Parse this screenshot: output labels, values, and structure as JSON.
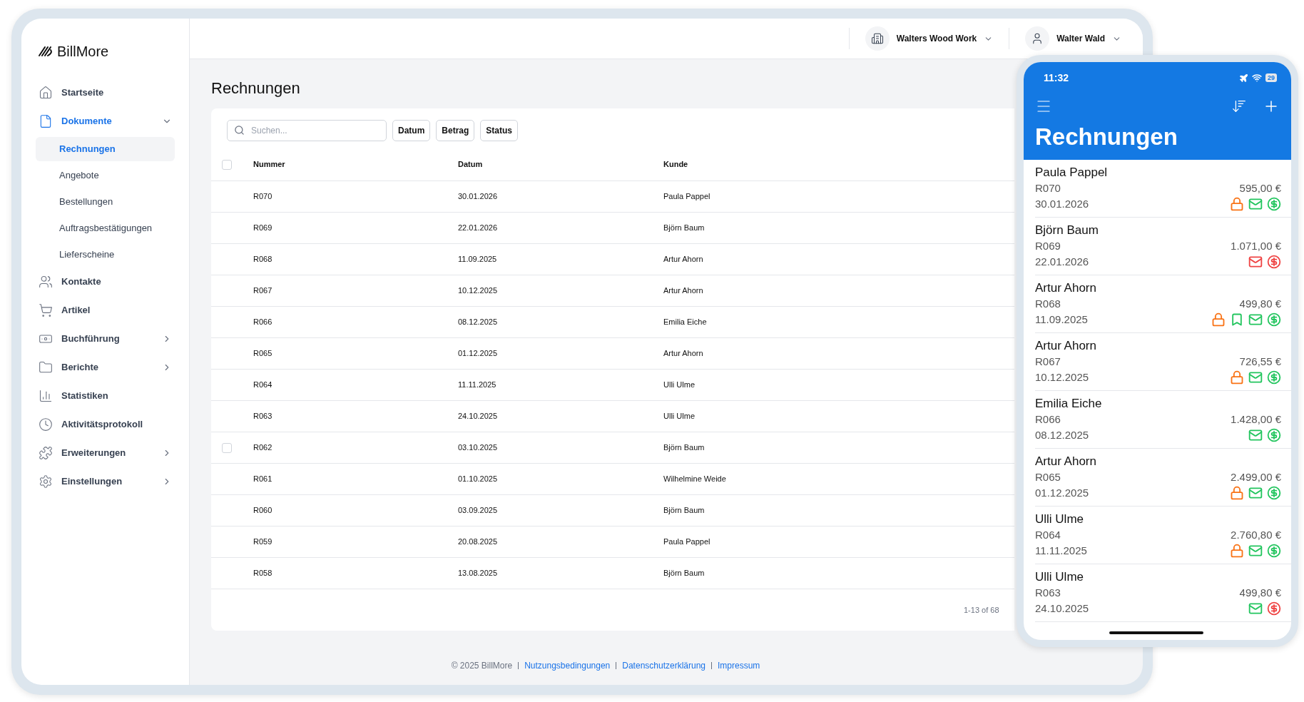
{
  "brand": "BillMore",
  "sidebar": {
    "items": [
      {
        "label": "Startseite",
        "selected": false
      },
      {
        "label": "Dokumente",
        "selected": true,
        "expanded": true,
        "children": [
          {
            "label": "Rechnungen",
            "selected": true
          },
          {
            "label": "Angebote",
            "selected": false
          },
          {
            "label": "Bestellungen",
            "selected": false
          },
          {
            "label": "Auftragsbestätigungen",
            "selected": false
          },
          {
            "label": "Lieferscheine",
            "selected": false
          }
        ]
      },
      {
        "label": "Kontakte",
        "selected": false
      },
      {
        "label": "Artikel",
        "selected": false
      },
      {
        "label": "Buchführung",
        "selected": false,
        "expanded": false
      },
      {
        "label": "Berichte",
        "selected": false,
        "expanded": false
      },
      {
        "label": "Statistiken",
        "selected": false
      },
      {
        "label": "Aktivitätsprotokoll",
        "selected": false
      },
      {
        "label": "Erweiterungen",
        "selected": false,
        "expanded": false
      },
      {
        "label": "Einstellungen",
        "selected": false,
        "expanded": false
      }
    ]
  },
  "header": {
    "company": "Walters Wood Work",
    "user": "Walter Wald"
  },
  "page_title": "Rechnungen",
  "search": {
    "placeholder": "Suchen..."
  },
  "filters": [
    "Datum",
    "Betrag",
    "Status"
  ],
  "table": {
    "select_all": {
      "checked": false
    },
    "columns": [
      "Nummer",
      "Datum",
      "Kunde"
    ],
    "rows": [
      {
        "cells": [
          "R070",
          "30.01.2026",
          "Paula Pappel"
        ]
      },
      {
        "cells": [
          "R069",
          "22.01.2026",
          "Björn Baum"
        ]
      },
      {
        "cells": [
          "R068",
          "11.09.2025",
          "Artur Ahorn"
        ]
      },
      {
        "cells": [
          "R067",
          "10.12.2025",
          "Artur Ahorn"
        ]
      },
      {
        "cells": [
          "R066",
          "08.12.2025",
          "Emilia Eiche"
        ]
      },
      {
        "cells": [
          "R065",
          "01.12.2025",
          "Artur Ahorn"
        ]
      },
      {
        "cells": [
          "R064",
          "11.11.2025",
          "Ulli Ulme"
        ]
      },
      {
        "cells": [
          "R063",
          "24.10.2025",
          "Ulli Ulme"
        ]
      },
      {
        "cells": [
          "R062",
          "03.10.2025",
          "Björn Baum"
        ],
        "checked": false
      },
      {
        "cells": [
          "R061",
          "01.10.2025",
          "Wilhelmine Weide"
        ]
      },
      {
        "cells": [
          "R060",
          "03.09.2025",
          "Björn Baum"
        ]
      },
      {
        "cells": [
          "R059",
          "20.08.2025",
          "Paula Pappel"
        ]
      },
      {
        "cells": [
          "R058",
          "13.08.2025",
          "Björn Baum"
        ]
      }
    ],
    "pagination": "1-13 of 68"
  },
  "footer": {
    "copyright": "© 2025 BillMore",
    "links": [
      "Nutzungsbedingungen",
      "Datenschutzerklärung",
      "Impressum"
    ]
  },
  "phone": {
    "time": "11:32",
    "battery": "29",
    "title": "Rechnungen",
    "items": [
      {
        "customer": "Paula Pappel",
        "number": "R070",
        "date": "30.01.2026",
        "amount": "595,00 €",
        "icons": [
          {
            "kind": "lock",
            "color": "#f97316"
          },
          {
            "kind": "mail",
            "color": "#22c55e"
          },
          {
            "kind": "dollar",
            "color": "#22c55e"
          }
        ]
      },
      {
        "customer": "Björn Baum",
        "number": "R069",
        "date": "22.01.2026",
        "amount": "1.071,00 €",
        "icons": [
          {
            "kind": "mail",
            "color": "#ef4444"
          },
          {
            "kind": "dollar",
            "color": "#ef4444"
          }
        ]
      },
      {
        "customer": "Artur Ahorn",
        "number": "R068",
        "date": "11.09.2025",
        "amount": "499,80 €",
        "icons": [
          {
            "kind": "lock",
            "color": "#f97316"
          },
          {
            "kind": "bookmark",
            "color": "#22c55e"
          },
          {
            "kind": "mail",
            "color": "#22c55e"
          },
          {
            "kind": "dollar",
            "color": "#22c55e"
          }
        ]
      },
      {
        "customer": "Artur Ahorn",
        "number": "R067",
        "date": "10.12.2025",
        "amount": "726,55 €",
        "icons": [
          {
            "kind": "lock",
            "color": "#f97316"
          },
          {
            "kind": "mail",
            "color": "#22c55e"
          },
          {
            "kind": "dollar",
            "color": "#22c55e"
          }
        ]
      },
      {
        "customer": "Emilia Eiche",
        "number": "R066",
        "date": "08.12.2025",
        "amount": "1.428,00 €",
        "icons": [
          {
            "kind": "mail",
            "color": "#22c55e"
          },
          {
            "kind": "dollar",
            "color": "#22c55e"
          }
        ]
      },
      {
        "customer": "Artur Ahorn",
        "number": "R065",
        "date": "01.12.2025",
        "amount": "2.499,00 €",
        "icons": [
          {
            "kind": "lock",
            "color": "#f97316"
          },
          {
            "kind": "mail",
            "color": "#22c55e"
          },
          {
            "kind": "dollar",
            "color": "#22c55e"
          }
        ]
      },
      {
        "customer": "Ulli Ulme",
        "number": "R064",
        "date": "11.11.2025",
        "amount": "2.760,80 €",
        "icons": [
          {
            "kind": "lock",
            "color": "#f97316"
          },
          {
            "kind": "mail",
            "color": "#22c55e"
          },
          {
            "kind": "dollar",
            "color": "#22c55e"
          }
        ]
      },
      {
        "customer": "Ulli Ulme",
        "number": "R063",
        "date": "24.10.2025",
        "amount": "499,80 €",
        "icons": [
          {
            "kind": "mail",
            "color": "#22c55e"
          },
          {
            "kind": "dollar",
            "color": "#ef4444"
          }
        ]
      }
    ]
  }
}
